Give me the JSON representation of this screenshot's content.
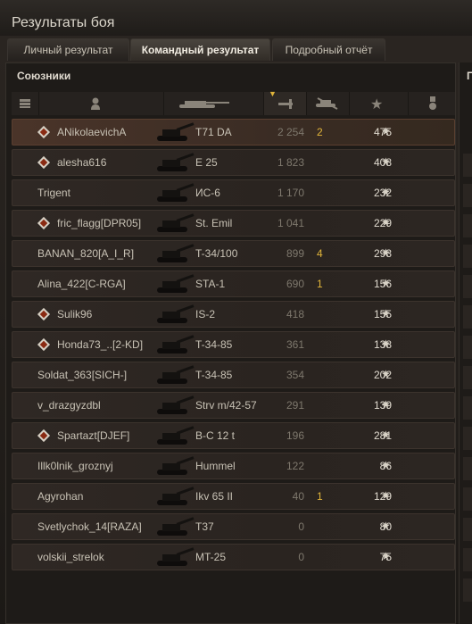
{
  "window": {
    "title": "Результаты боя"
  },
  "tabs": [
    {
      "label": "Личный результат",
      "active": false
    },
    {
      "label": "Командный результат",
      "active": true
    },
    {
      "label": "Подробный отчёт",
      "active": false
    }
  ],
  "allies": {
    "title": "Союзники"
  },
  "enemies": {
    "title": "П"
  },
  "columns": {
    "icons": [
      "platoon-icon",
      "player-icon",
      "tank-icon",
      "sort-arrow-icon",
      "damage-icon",
      "kills-icon",
      "xp-star-icon",
      "medal-icon"
    ]
  },
  "rows": [
    {
      "name": "ANikolaevichA",
      "rank": true,
      "tank": "T71 DA",
      "damage": "2 254",
      "kills": "2",
      "xp": "475",
      "highlight": true
    },
    {
      "name": "alesha616",
      "rank": true,
      "tank": "E 25",
      "damage": "1 823",
      "kills": "",
      "xp": "408",
      "highlight": false
    },
    {
      "name": "Trigent",
      "rank": false,
      "tank": "ИС-6",
      "damage": "1 170",
      "kills": "",
      "xp": "232",
      "highlight": false
    },
    {
      "name": "fric_flagg[DPR05]",
      "rank": true,
      "tank": "St. Emil",
      "damage": "1 041",
      "kills": "",
      "xp": "229",
      "highlight": false
    },
    {
      "name": "BANAN_820[A_I_R]",
      "rank": false,
      "tank": "T-34/100",
      "damage": "899",
      "kills": "4",
      "xp": "293",
      "highlight": false
    },
    {
      "name": "Alina_422[C-RGA]",
      "rank": false,
      "tank": "STA-1",
      "damage": "690",
      "kills": "1",
      "xp": "156",
      "highlight": false
    },
    {
      "name": "Sulik96",
      "rank": true,
      "tank": "IS-2",
      "damage": "418",
      "kills": "",
      "xp": "155",
      "highlight": false
    },
    {
      "name": "Honda73_..[2-KD]",
      "rank": true,
      "tank": "T-34-85",
      "damage": "361",
      "kills": "",
      "xp": "138",
      "highlight": false
    },
    {
      "name": "Soldat_363[SICH-]",
      "rank": false,
      "tank": "T-34-85",
      "damage": "354",
      "kills": "",
      "xp": "202",
      "highlight": false
    },
    {
      "name": "v_drazgyzdbl",
      "rank": false,
      "tank": "Strv m/42-57",
      "damage": "291",
      "kills": "",
      "xp": "139",
      "highlight": false
    },
    {
      "name": "Spartazt[DJEF]",
      "rank": true,
      "tank": "B-C 12 t",
      "damage": "196",
      "kills": "",
      "xp": "281",
      "highlight": false
    },
    {
      "name": "Illk0lnik_groznyj",
      "rank": false,
      "tank": "Hummel",
      "damage": "122",
      "kills": "",
      "xp": "86",
      "highlight": false
    },
    {
      "name": "Agyrohan",
      "rank": false,
      "tank": "Ikv 65 II",
      "damage": "40",
      "kills": "1",
      "xp": "129",
      "highlight": false
    },
    {
      "name": "Svetlychok_14[RAZA]",
      "rank": false,
      "tank": "T37",
      "damage": "0",
      "kills": "",
      "xp": "80",
      "highlight": false
    },
    {
      "name": "volskii_strelok",
      "rank": false,
      "tank": "MT-25",
      "damage": "0",
      "kills": "",
      "xp": "75",
      "highlight": false
    }
  ],
  "star_glyph": "★"
}
